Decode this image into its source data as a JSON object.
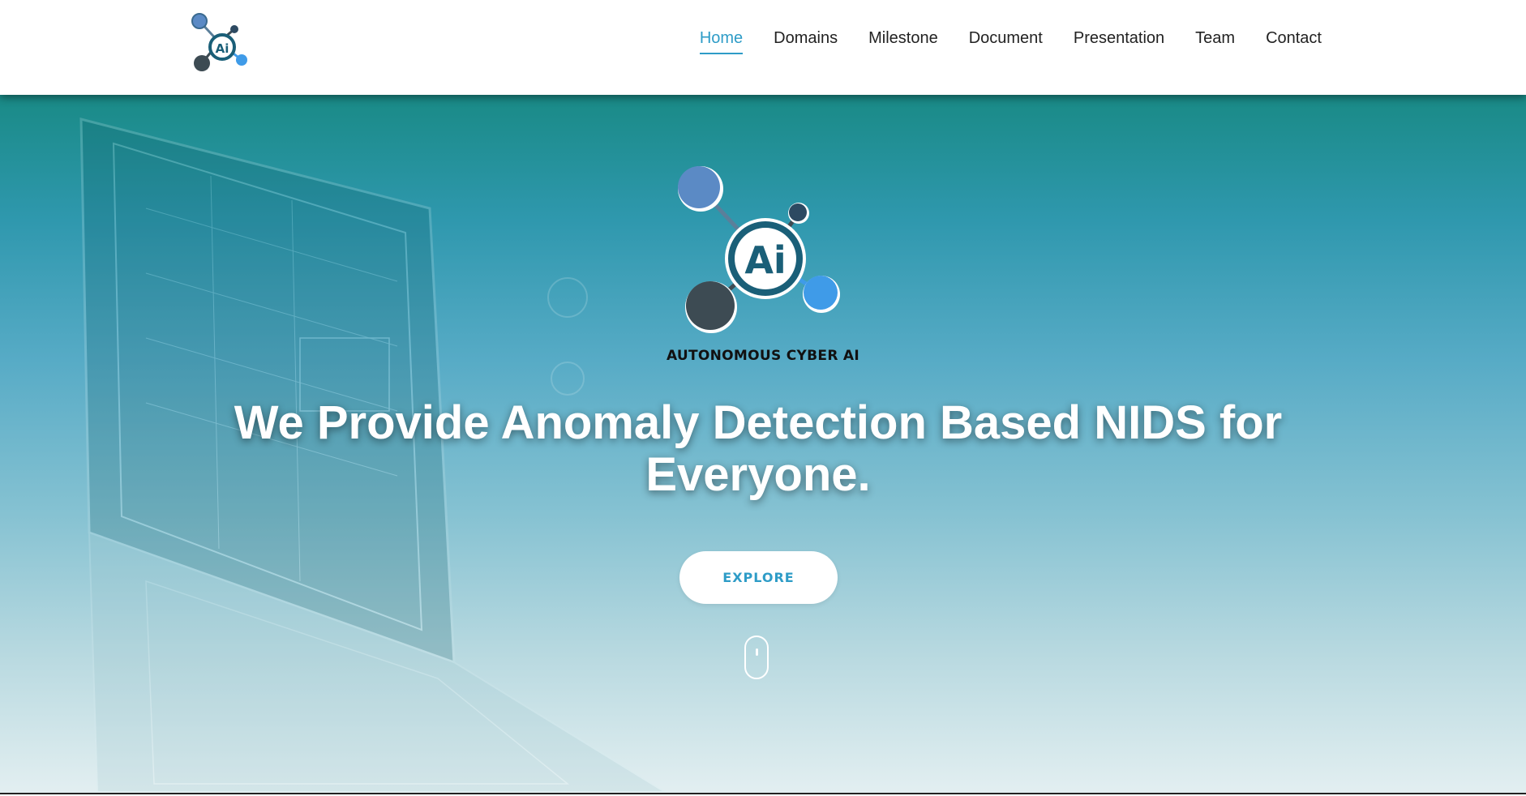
{
  "header": {
    "logo_icon": "ai-molecule-logo-icon",
    "nav": [
      {
        "label": "Home",
        "active": true
      },
      {
        "label": "Domains",
        "active": false
      },
      {
        "label": "Milestone",
        "active": false
      },
      {
        "label": "Document",
        "active": false
      },
      {
        "label": "Presentation",
        "active": false
      },
      {
        "label": "Team",
        "active": false
      },
      {
        "label": "Contact",
        "active": false
      }
    ]
  },
  "hero": {
    "logo_icon": "ai-molecule-logo-icon",
    "logo_center_text": "Ai",
    "brand_name": "AUTONOMOUS CYBER AI",
    "headline_line1": "We Provide Anomaly Detection Based NIDS for",
    "headline_line2": "Everyone.",
    "cta_label": "EXPLORE",
    "scroll_icon": "mouse-scroll-icon"
  },
  "colors": {
    "accent": "#2e9cc7",
    "hero_top": "#198a86",
    "hero_bottom": "#e3eff1",
    "logo_dark": "#1a5f78",
    "logo_blue": "#5b8ac5",
    "logo_light_blue": "#3f9be8",
    "logo_charcoal": "#3d4b53"
  }
}
